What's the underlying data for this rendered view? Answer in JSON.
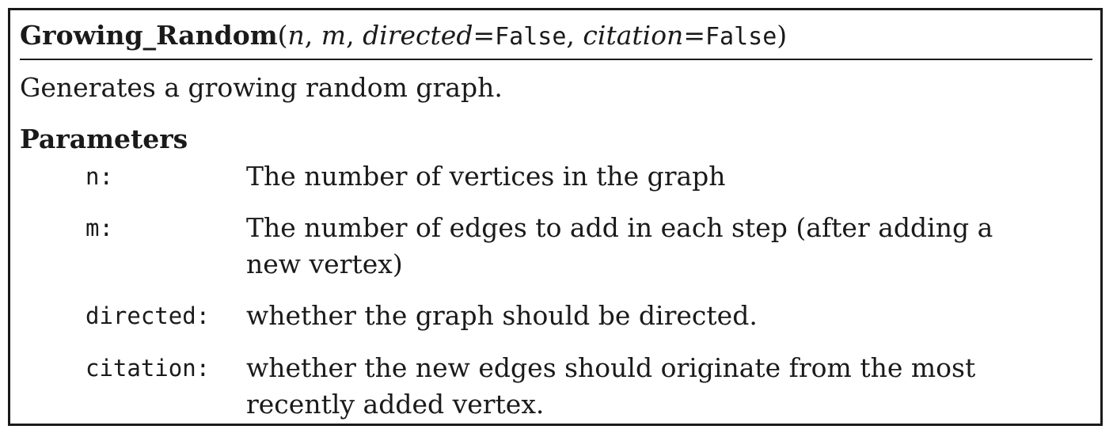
{
  "signature": {
    "name": "Growing_Random",
    "open_paren": "(",
    "arg1": "n",
    "sep1": ", ",
    "arg2": "m",
    "sep2": ", ",
    "arg3": "directed",
    "eq3": "=",
    "val3": "False",
    "sep3": ", ",
    "arg4": "citation",
    "eq4": "=",
    "val4": "False",
    "close_paren": ")"
  },
  "description": "Generates a growing random graph.",
  "parameters_heading": "Parameters",
  "parameters": [
    {
      "name": "n:",
      "description": "The number of vertices in the graph"
    },
    {
      "name": "m:",
      "description": "The number of edges to add in each step (after adding a new vertex)"
    },
    {
      "name": "directed:",
      "description": "whether the graph should be directed."
    },
    {
      "name": "citation:",
      "description": "whether the new edges should originate from the most recently added vertex."
    }
  ]
}
